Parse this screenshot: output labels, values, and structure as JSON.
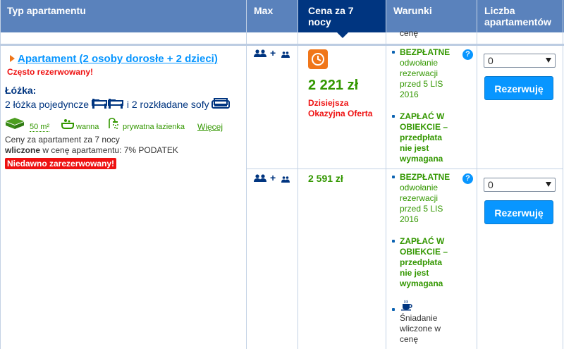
{
  "header": {
    "col_type": "Typ apartamentu",
    "col_max": "Max",
    "col_price": "Cena za 7 nocy",
    "col_conditions": "Warunki",
    "col_count": "Liczba apartamentów"
  },
  "top_overflow": {
    "text": "cenę"
  },
  "apartment": {
    "title": "Apartament (2 osoby dorosłe + 2 dzieci)",
    "popular": "Często rezerwowany!",
    "beds_label": "Łóżka:",
    "beds_single": "2 łóżka pojedyncze",
    "beds_and": "i 2 rozkładane sofy",
    "size": "50 m²",
    "bath": "wanna",
    "private_bath": "prywatna łazienka",
    "more": "Więcej",
    "price_note": "Ceny za apartament za 7 nocy",
    "included_bold": "wliczone",
    "included_rest": " w cenę apartamentu: 7% PODATEK",
    "recent_badge": "Niedawno zarezerwowany!"
  },
  "rows": [
    {
      "max_plus": "+",
      "price": "2 221 zł",
      "deal": "Dzisiejsza Okazyjna Oferta",
      "cancel": [
        "BEZPŁATNE",
        "odwołanie",
        "rezerwacji",
        "przed 5 LIS",
        "2016"
      ],
      "pay": [
        "ZAPŁAĆ W",
        "OBIEKCIE –",
        "przedpłata",
        "nie jest",
        "wymagana"
      ],
      "select_value": "0",
      "button": "Rezerwuję"
    },
    {
      "max_plus": "+",
      "price": "2 591 zł",
      "cancel": [
        "BEZPŁATNE",
        "odwołanie",
        "rezerwacji",
        "przed 5 LIS",
        "2016"
      ],
      "pay": [
        "ZAPŁAĆ W",
        "OBIEKCIE –",
        "przedpłata",
        "nie jest",
        "wymagana"
      ],
      "breakfast": [
        "Śniadanie",
        "wliczone w",
        "cenę"
      ],
      "select_value": "0",
      "button": "Rezerwuję"
    }
  ],
  "colors": {
    "header": "#5a82bc",
    "price_header": "#003580",
    "accent": "#0896ff",
    "green": "#339700",
    "red": "#e11111",
    "deal": "#f0761a"
  },
  "icons": [
    "persons-icon",
    "child-icon",
    "bed-icon",
    "sofa-icon",
    "area-icon",
    "bathtub-icon",
    "shower-icon",
    "deal-icon",
    "coffee-icon",
    "info-icon",
    "caret-down-icon"
  ]
}
